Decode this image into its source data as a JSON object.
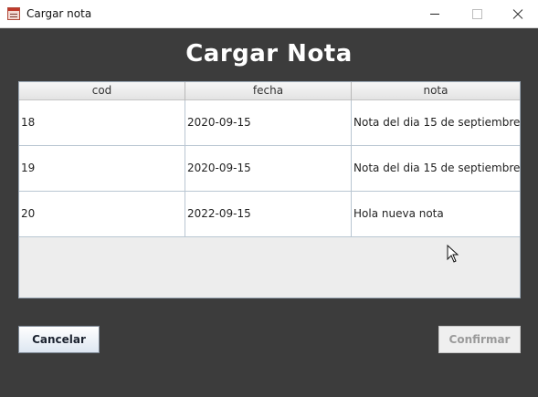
{
  "window": {
    "title": "Cargar nota"
  },
  "form": {
    "heading": "Cargar Nota"
  },
  "table": {
    "columns": [
      "cod",
      "fecha",
      "nota"
    ],
    "rows": [
      {
        "cod": "18",
        "fecha": "2020-09-15",
        "nota": "Nota del dia 15 de septiembre ..."
      },
      {
        "cod": "19",
        "fecha": "2020-09-15",
        "nota": "Nota del dia 15 de septiembre ..."
      },
      {
        "cod": "20",
        "fecha": "2022-09-15",
        "nota": "Hola nueva nota"
      }
    ]
  },
  "buttons": {
    "cancel": "Cancelar",
    "confirm": "Confirmar",
    "confirm_enabled": false
  },
  "icons": {
    "app": "calendar-icon",
    "minimize": "minimize-icon",
    "maximize": "maximize-icon",
    "close": "close-icon",
    "cursor": "mouse-pointer-icon"
  }
}
